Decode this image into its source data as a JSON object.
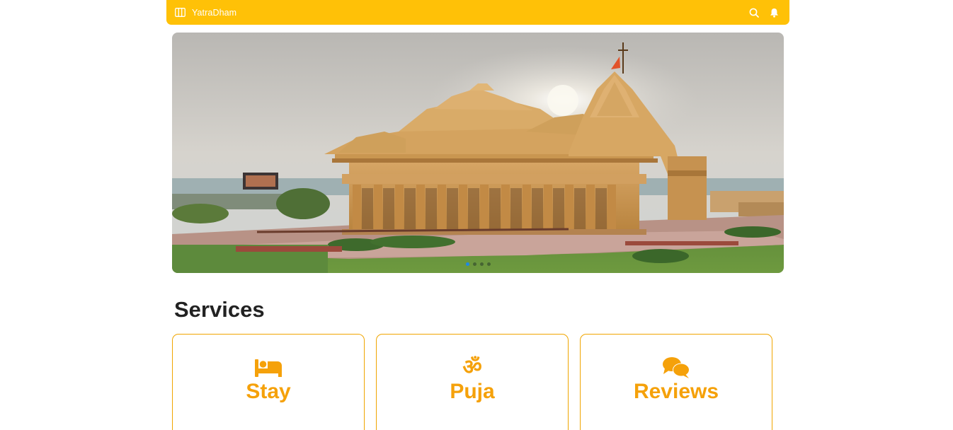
{
  "topbar": {
    "brand": "YatraDham",
    "menu_icon": "menu-columns-icon",
    "search_icon": "search-icon",
    "notification_icon": "bell-icon",
    "background_color": "#ffc107"
  },
  "carousel": {
    "slide_image": "somnath-temple-photo",
    "slide_count": 4,
    "active_index": 0,
    "active_dot_color": "#1e88e5"
  },
  "services": {
    "title": "Services",
    "accent_color": "#f5a10a",
    "items": [
      {
        "label": "Stay",
        "icon": "bed-icon"
      },
      {
        "label": "Puja",
        "icon": "om-icon",
        "glyph": "ॐ"
      },
      {
        "label": "Reviews",
        "icon": "chat-bubbles-icon"
      }
    ]
  }
}
